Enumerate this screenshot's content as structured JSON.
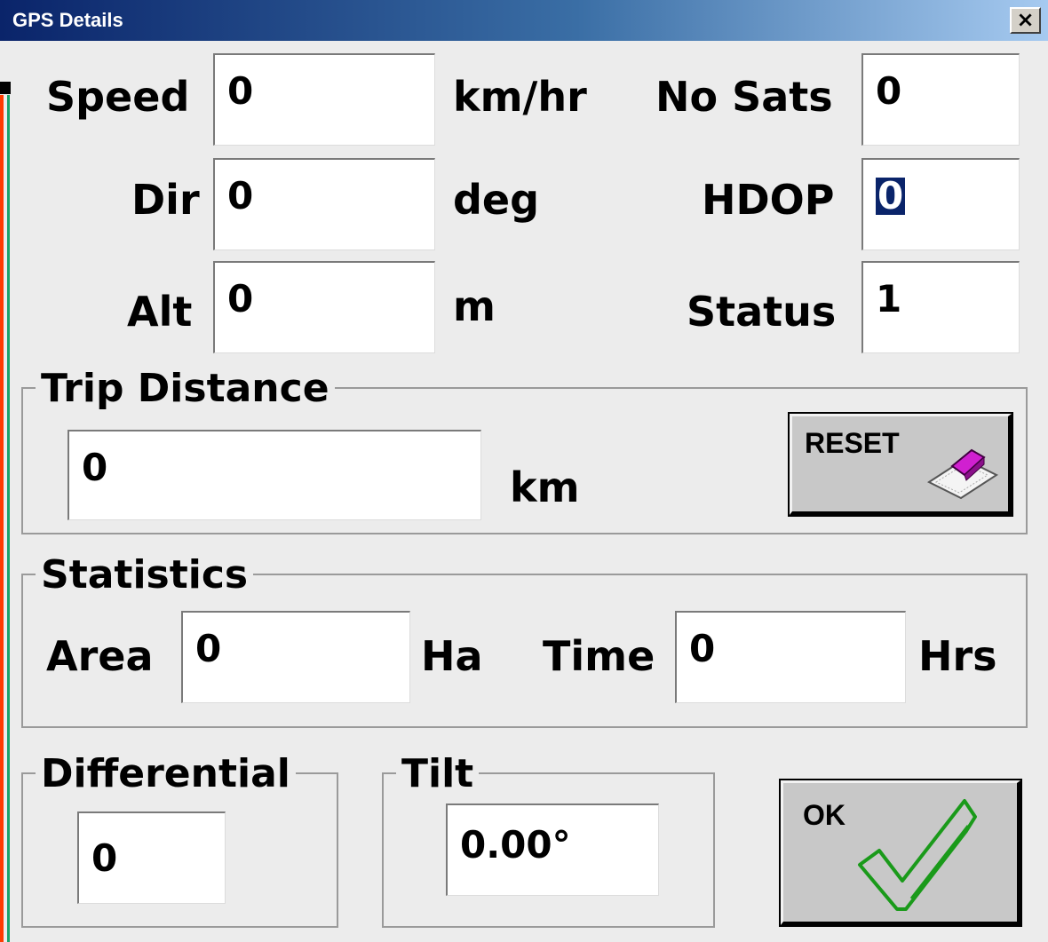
{
  "window": {
    "title": "GPS Details",
    "close_glyph": "✕"
  },
  "gps": {
    "speed": {
      "label": "Speed",
      "value": "0",
      "unit": "km/hr"
    },
    "dir": {
      "label": "Dir",
      "value": "0",
      "unit": "deg"
    },
    "alt": {
      "label": "Alt",
      "value": "0",
      "unit": "m"
    },
    "no_sats": {
      "label": "No Sats",
      "value": "0"
    },
    "hdop": {
      "label": "HDOP",
      "value": "0"
    },
    "status": {
      "label": "Status",
      "value": "1"
    }
  },
  "trip": {
    "title": "Trip Distance",
    "value": "0",
    "unit": "km",
    "reset_label": "RESET",
    "reset_icon": "eraser-icon"
  },
  "statistics": {
    "title": "Statistics",
    "area": {
      "label": "Area",
      "value": "0",
      "unit": "Ha"
    },
    "time": {
      "label": "Time",
      "value": "0",
      "unit": "Hrs"
    }
  },
  "differential": {
    "title": "Differential",
    "value": "0"
  },
  "tilt": {
    "title": "Tilt",
    "value": "0.00°"
  },
  "ok": {
    "label": "OK",
    "icon": "checkmark-icon"
  },
  "colors": {
    "title_start": "#0a246a",
    "title_end": "#a6caf0",
    "check_green": "#1a9a1a",
    "eraser_pink": "#d020d0"
  }
}
